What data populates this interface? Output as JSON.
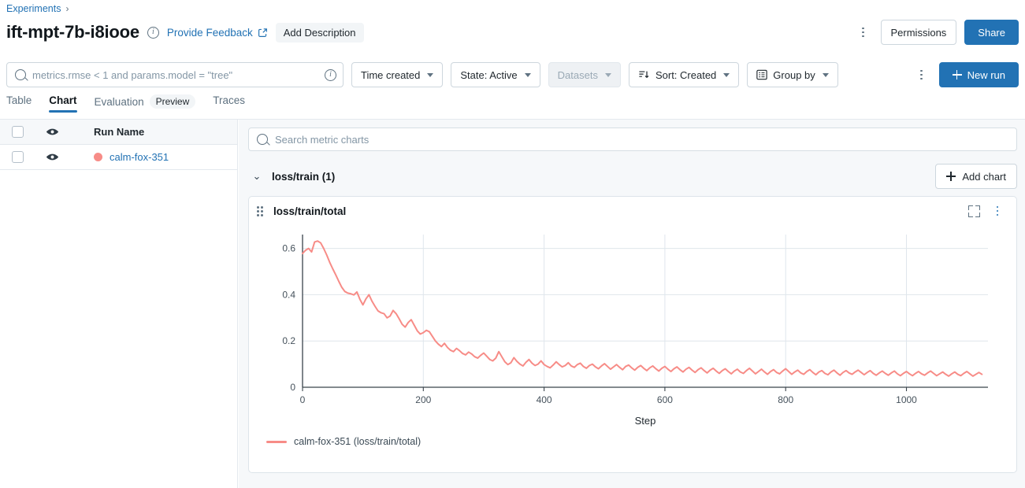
{
  "breadcrumb": {
    "root": "Experiments",
    "separator": "›"
  },
  "header": {
    "title": "ift-mpt-7b-i8iooe",
    "info_icon": "info-icon",
    "feedback_label": "Provide Feedback",
    "external_link_icon": "external-link-icon",
    "add_description_label": "Add Description",
    "overflow_icon": "kebab-menu-icon",
    "permissions_label": "Permissions",
    "share_label": "Share",
    "accent": "#2272b4"
  },
  "toolbar": {
    "search_placeholder": "metrics.rmse < 1 and params.model = \"tree\"",
    "search_value": "",
    "search_icon": "search-icon",
    "search_info_icon": "info-icon",
    "time_created_label": "Time created",
    "state_label": "State: Active",
    "datasets_label": "Datasets",
    "datasets_disabled": true,
    "sort_label": "Sort: Created",
    "sort_icon": "sort-descending-icon",
    "group_by_label": "Group by",
    "group_by_icon": "list-icon",
    "overflow_icon": "kebab-menu-icon",
    "new_run_label": "New run",
    "new_run_icon": "plus-icon"
  },
  "tabs": [
    {
      "label": "Table",
      "active": false
    },
    {
      "label": "Chart",
      "active": true
    },
    {
      "label": "Evaluation",
      "badge": "Preview",
      "active": false
    },
    {
      "label": "Traces",
      "active": false
    }
  ],
  "runs_panel": {
    "header": {
      "run_name": "Run Name",
      "checkbox_icon": "checkbox-icon",
      "eye_icon": "eye-icon"
    },
    "rows": [
      {
        "name": "calm-fox-351",
        "color": "#f78c87",
        "checked": false,
        "visible": true
      }
    ]
  },
  "charts_panel": {
    "search_placeholder": "Search metric charts",
    "search_icon": "search-icon",
    "section": {
      "title": "loss/train (1)",
      "expanded": true,
      "chevron_icon": "chevron-down-icon",
      "add_chart_label": "Add chart",
      "add_chart_icon": "plus-icon"
    },
    "card": {
      "title": "loss/train/total",
      "grip_icon": "drag-handle-icon",
      "expand_icon": "fullscreen-icon",
      "overflow_icon": "kebab-menu-icon"
    }
  },
  "chart_data": {
    "type": "line",
    "title": "loss/train/total",
    "xlabel": "Step",
    "ylabel": "",
    "xlim": [
      0,
      1135
    ],
    "ylim": [
      0,
      0.66
    ],
    "xticks": [
      0,
      200,
      400,
      600,
      800,
      1000
    ],
    "yticks": [
      0,
      0.2,
      0.4,
      0.6
    ],
    "grid": "horizontal+vertical",
    "legend_position": "bottom-left",
    "series": [
      {
        "name": "calm-fox-351 (loss/train/total)",
        "color": "#f78c87",
        "x_start": 0,
        "x_step": 5,
        "values": [
          0.578,
          0.592,
          0.6,
          0.585,
          0.628,
          0.632,
          0.624,
          0.6,
          0.572,
          0.54,
          0.512,
          0.486,
          0.458,
          0.432,
          0.414,
          0.407,
          0.404,
          0.399,
          0.412,
          0.38,
          0.356,
          0.382,
          0.4,
          0.372,
          0.35,
          0.33,
          0.322,
          0.318,
          0.3,
          0.308,
          0.332,
          0.318,
          0.296,
          0.272,
          0.26,
          0.28,
          0.292,
          0.268,
          0.244,
          0.23,
          0.236,
          0.246,
          0.24,
          0.22,
          0.2,
          0.186,
          0.176,
          0.19,
          0.172,
          0.16,
          0.154,
          0.168,
          0.158,
          0.146,
          0.14,
          0.152,
          0.144,
          0.132,
          0.126,
          0.138,
          0.148,
          0.134,
          0.12,
          0.114,
          0.126,
          0.154,
          0.132,
          0.11,
          0.098,
          0.106,
          0.128,
          0.112,
          0.1,
          0.092,
          0.108,
          0.12,
          0.104,
          0.094,
          0.1,
          0.114,
          0.098,
          0.09,
          0.084,
          0.096,
          0.11,
          0.098,
          0.088,
          0.094,
          0.106,
          0.092,
          0.086,
          0.098,
          0.104,
          0.09,
          0.082,
          0.094,
          0.1,
          0.088,
          0.08,
          0.092,
          0.102,
          0.09,
          0.078,
          0.088,
          0.098,
          0.086,
          0.076,
          0.09,
          0.096,
          0.084,
          0.074,
          0.086,
          0.094,
          0.082,
          0.072,
          0.084,
          0.092,
          0.08,
          0.07,
          0.082,
          0.09,
          0.078,
          0.068,
          0.08,
          0.088,
          0.076,
          0.066,
          0.078,
          0.086,
          0.074,
          0.064,
          0.076,
          0.084,
          0.072,
          0.062,
          0.074,
          0.082,
          0.07,
          0.06,
          0.072,
          0.08,
          0.068,
          0.058,
          0.07,
          0.078,
          0.066,
          0.06,
          0.072,
          0.082,
          0.07,
          0.058,
          0.068,
          0.078,
          0.066,
          0.056,
          0.068,
          0.076,
          0.064,
          0.058,
          0.07,
          0.08,
          0.068,
          0.056,
          0.066,
          0.074,
          0.062,
          0.056,
          0.068,
          0.076,
          0.064,
          0.054,
          0.066,
          0.072,
          0.06,
          0.054,
          0.066,
          0.074,
          0.062,
          0.052,
          0.064,
          0.072,
          0.062,
          0.056,
          0.066,
          0.074,
          0.064,
          0.054,
          0.064,
          0.072,
          0.06,
          0.052,
          0.062,
          0.07,
          0.06,
          0.052,
          0.062,
          0.07,
          0.058,
          0.05,
          0.06,
          0.068,
          0.058,
          0.05,
          0.06,
          0.068,
          0.058,
          0.052,
          0.062,
          0.07,
          0.06,
          0.05,
          0.058,
          0.066,
          0.056,
          0.048,
          0.058,
          0.066,
          0.056,
          0.05,
          0.06,
          0.068,
          0.058,
          0.048,
          0.056,
          0.064,
          0.056
        ]
      }
    ]
  }
}
